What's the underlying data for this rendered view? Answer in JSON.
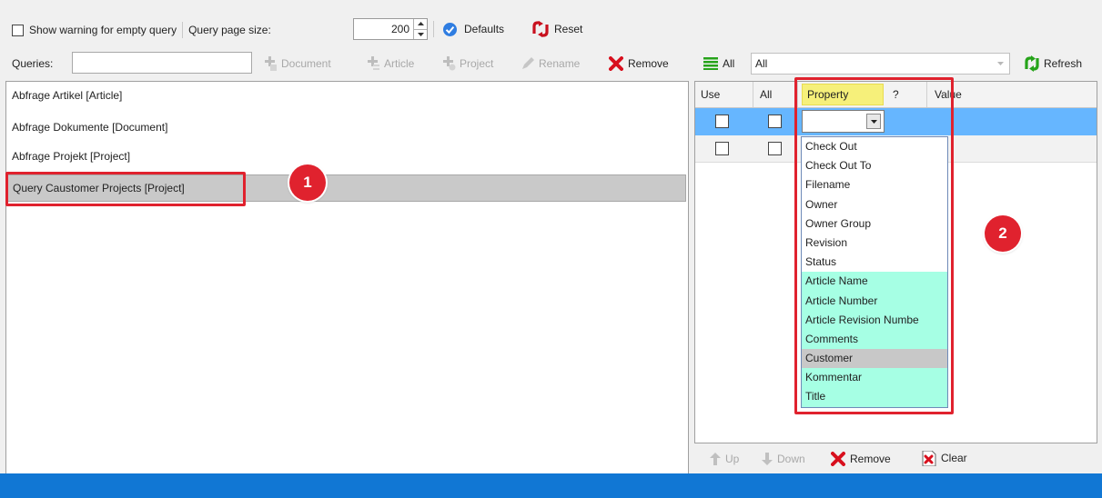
{
  "toolbar": {
    "show_warning_label": "Show warning for empty query",
    "page_size_label": "Query page size:",
    "page_size_value": "200",
    "defaults_label": "Defaults",
    "reset_label": "Reset"
  },
  "queries_bar": {
    "label": "Queries:",
    "search_value": "",
    "document_label": "Document",
    "article_label": "Article",
    "project_label": "Project",
    "rename_label": "Rename",
    "remove_label": "Remove"
  },
  "queries": [
    "Abfrage Artikel [Article]",
    "Abfrage Dokumente [Document]",
    "Abfrage Projekt [Project]",
    "Query Caustomer Projects [Project]"
  ],
  "filter_bar": {
    "all_label": "All",
    "dropdown_value": "All",
    "refresh_label": "Refresh"
  },
  "grid": {
    "columns": [
      "Use",
      "All",
      "Property",
      "?",
      "Value"
    ]
  },
  "property_dropdown": {
    "items": [
      "Check Out",
      "Check Out To",
      "Filename",
      "Owner",
      "Owner Group",
      "Revision",
      "Status",
      "Article Name",
      "Article Number",
      "Article Revision Numbe",
      "Comments",
      "Customer",
      "Kommentar",
      "Title"
    ],
    "highlight_color": "#a6ffe4",
    "selected_color": "#c8c8c8"
  },
  "bottom_bar": {
    "up_label": "Up",
    "down_label": "Down",
    "remove_label": "Remove",
    "clear_label": "Clear"
  },
  "callouts": {
    "one": "1",
    "two": "2"
  },
  "colors": {
    "status_bar": "#1177d4",
    "selection": "#66b6ff",
    "accent_red": "#e0222e"
  }
}
